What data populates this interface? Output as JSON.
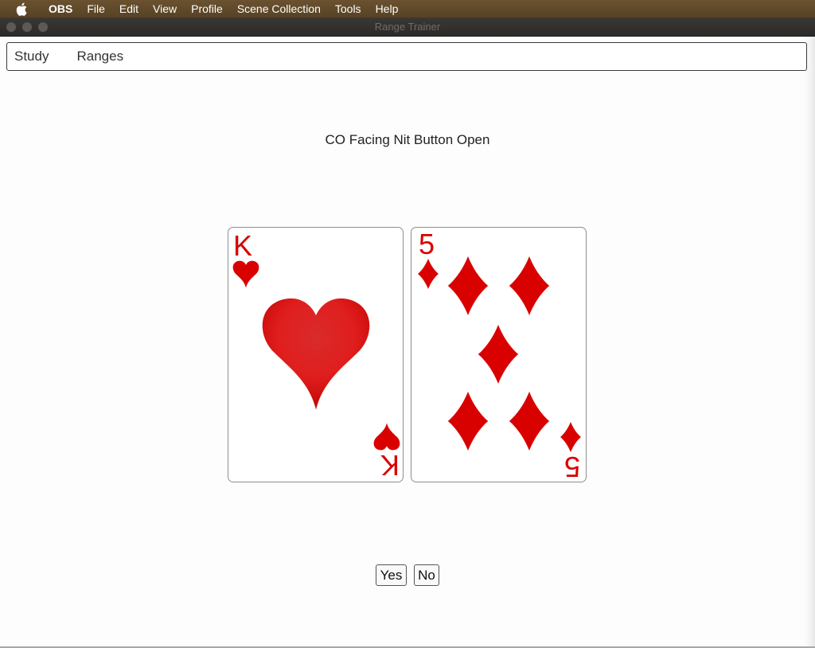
{
  "menubar": {
    "apple_icon": "apple-logo-icon",
    "items": [
      "OBS",
      "File",
      "Edit",
      "View",
      "Profile",
      "Scene Collection",
      "Tools",
      "Help"
    ]
  },
  "window": {
    "title": "Range Trainer"
  },
  "nav": {
    "tabs": [
      "Study",
      "Ranges"
    ]
  },
  "scenario": {
    "title": "CO Facing Nit Button Open"
  },
  "cards": [
    {
      "rank": "K",
      "suit": "hearts",
      "suit_icon": "heart-icon",
      "color": "#d90000"
    },
    {
      "rank": "5",
      "suit": "diamonds",
      "suit_icon": "diamond-icon",
      "color": "#d90000"
    }
  ],
  "buttons": {
    "yes": "Yes",
    "no": "No"
  },
  "colors": {
    "menubar": "#5f4a2b",
    "titlebar": "#302e2c",
    "card_red": "#d90000"
  }
}
